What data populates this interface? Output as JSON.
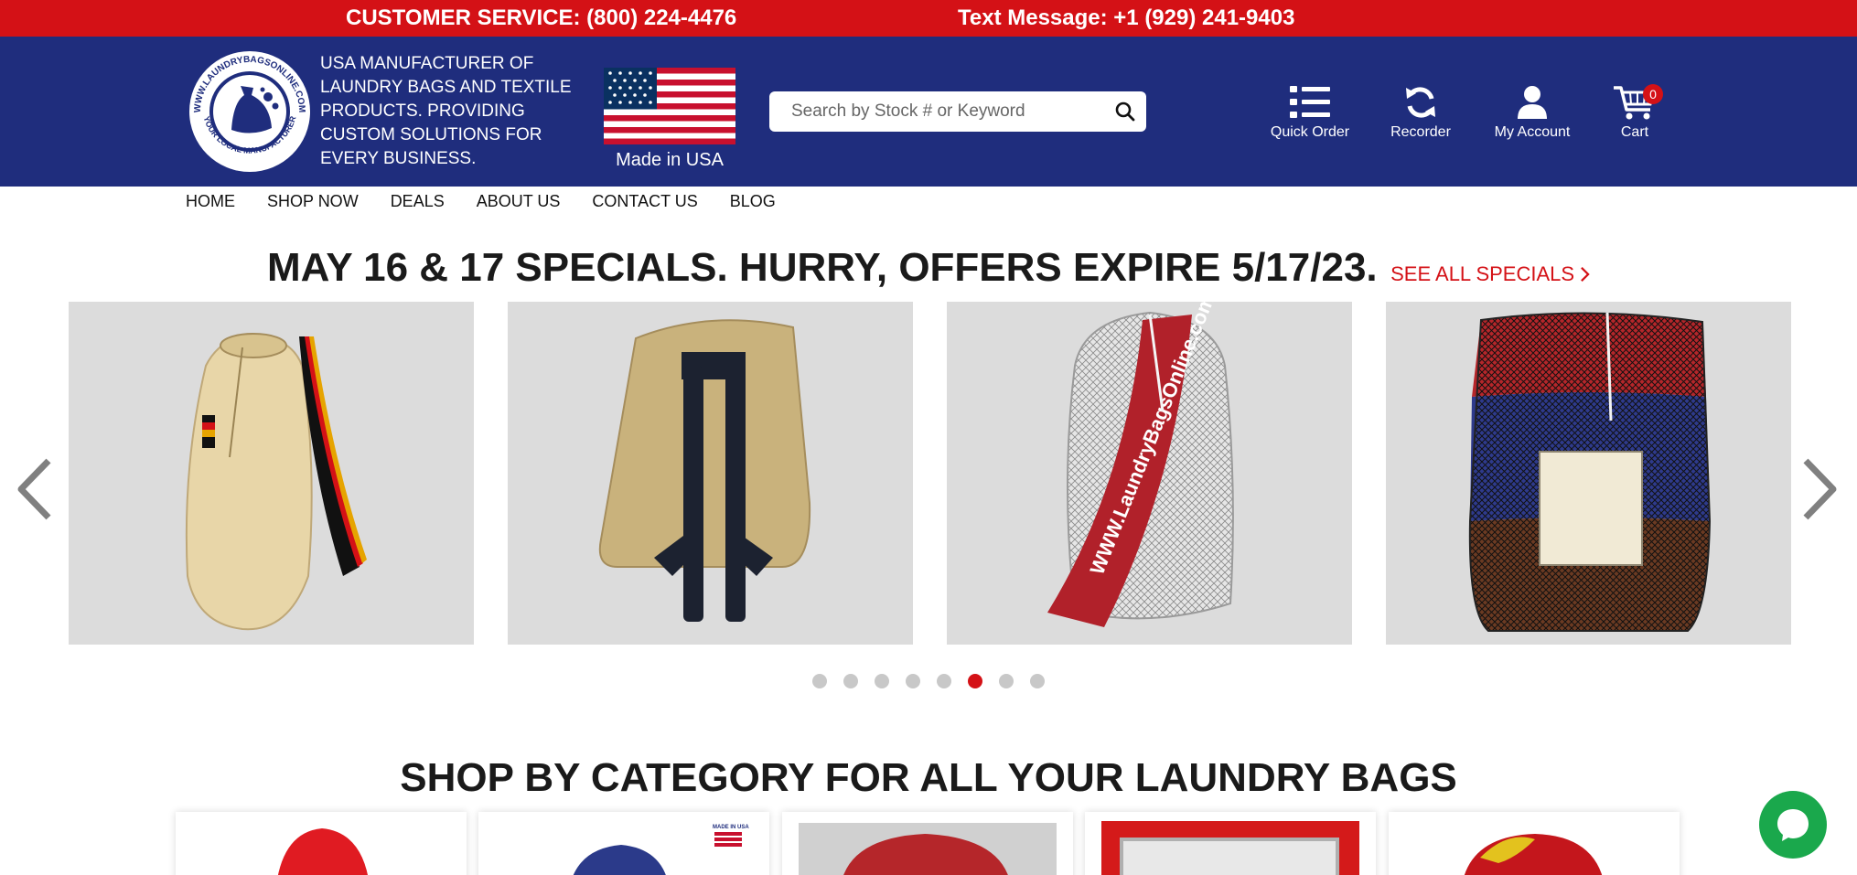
{
  "topbar": {
    "customer_service": "CUSTOMER SERVICE: (800) 224-4476",
    "text_message": "Text Message: +1 (929) 241-9403",
    "color": "#d41116"
  },
  "header": {
    "logo_text_top": "WWW.LAUNDRYBAGSONLINE.COM",
    "logo_text_bottom": "YOUR LOCAL MANUFACTURER",
    "tagline": "USA MANUFACTURER OF LAUNDRY BAGS AND TEXTILE PRODUCTS. PROVIDING CUSTOM SOLUTIONS FOR EVERY BUSINESS.",
    "made_in": "Made in USA",
    "background": "#1f2d7d"
  },
  "search": {
    "placeholder": "Search by Stock # or Keyword",
    "icon": "search-icon"
  },
  "header_icons": [
    {
      "label": "Quick Order",
      "icon": "list-icon"
    },
    {
      "label": "Recorder",
      "icon": "refresh-icon"
    },
    {
      "label": "My Account",
      "icon": "user-icon"
    },
    {
      "label": "Cart",
      "icon": "cart-icon",
      "count": "0"
    }
  ],
  "nav": [
    "HOME",
    "SHOP NOW",
    "DEALS",
    "ABOUT US",
    "CONTACT US",
    "BLOG"
  ],
  "promo": {
    "title": "MAY 16 & 17 SPECIALS. HURRY, OFFERS EXPIRE 5/17/23.",
    "link": "SEE ALL SPECIALS"
  },
  "carousel": {
    "slides": [
      {
        "name": "canvas duffel laundry bag",
        "color": "#e8d6a8"
      },
      {
        "name": "khaki laundry backpack",
        "color": "#c9b27c"
      },
      {
        "name": "white mesh bag with red logo strap",
        "color": "#f2f2f2",
        "print": "WWW.LaundryBagsOnline.com"
      },
      {
        "name": "multicolor mesh laundry bag",
        "color": "#2e3a8c"
      }
    ],
    "dot_count": 8,
    "active_dot": 6
  },
  "category": {
    "title": "SHOP BY CATEGORY FOR ALL YOUR LAUNDRY BAGS",
    "badge": "MADE IN USA"
  },
  "chat": {
    "icon": "chat-bubble-icon",
    "color": "#1aa84c"
  }
}
